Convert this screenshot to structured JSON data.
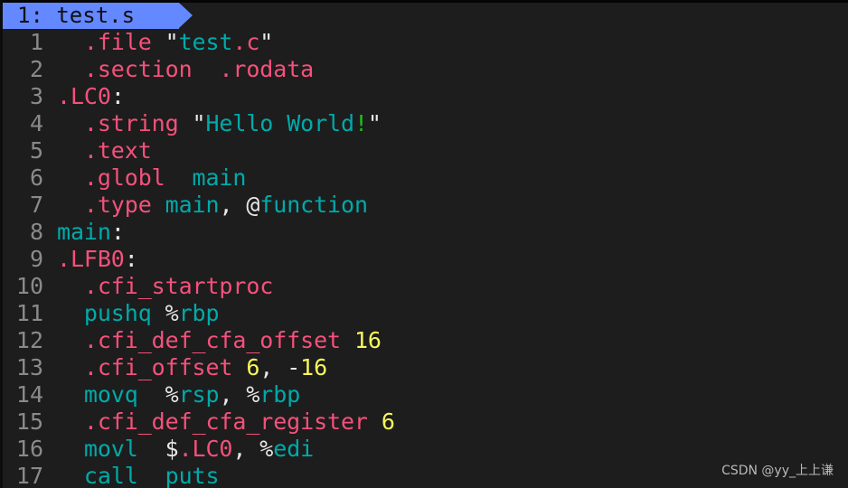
{
  "tabline": {
    "active_tab": "1: test.s"
  },
  "theme": {
    "background": "#1d1d1d",
    "tab_bg": "#6488ff",
    "directive_color": "#f5517b",
    "identifier_color": "#00aaaa",
    "number_color": "#f7f75a",
    "punct_color": "#e8e8e8",
    "escape_color": "#1fc11f",
    "line_number_color": "#8a8a8a"
  },
  "editor": {
    "lines": [
      {
        "n": "1",
        "tokens": [
          [
            "  ",
            "white"
          ],
          [
            ".file",
            "pink"
          ],
          [
            " \"",
            "white"
          ],
          [
            "test",
            "teal"
          ],
          [
            ".c",
            "pink"
          ],
          [
            "\"",
            "white"
          ]
        ]
      },
      {
        "n": "2",
        "tokens": [
          [
            "  ",
            "white"
          ],
          [
            ".section",
            "pink"
          ],
          [
            "  ",
            "white"
          ],
          [
            ".rodata",
            "pink"
          ]
        ]
      },
      {
        "n": "3",
        "tokens": [
          [
            ".LC0",
            "pink"
          ],
          [
            ":",
            "white"
          ]
        ]
      },
      {
        "n": "4",
        "tokens": [
          [
            "  ",
            "white"
          ],
          [
            ".string",
            "pink"
          ],
          [
            " \"",
            "white"
          ],
          [
            "Hello World",
            "teal"
          ],
          [
            "!",
            "green"
          ],
          [
            "\"",
            "white"
          ]
        ]
      },
      {
        "n": "5",
        "tokens": [
          [
            "  ",
            "white"
          ],
          [
            ".text",
            "pink"
          ]
        ]
      },
      {
        "n": "6",
        "tokens": [
          [
            "  ",
            "white"
          ],
          [
            ".globl",
            "pink"
          ],
          [
            "  ",
            "white"
          ],
          [
            "main",
            "teal"
          ]
        ]
      },
      {
        "n": "7",
        "tokens": [
          [
            "  ",
            "white"
          ],
          [
            ".type",
            "pink"
          ],
          [
            " ",
            "white"
          ],
          [
            "main",
            "teal"
          ],
          [
            ", ",
            "white"
          ],
          [
            "@",
            "white"
          ],
          [
            "function",
            "teal"
          ]
        ]
      },
      {
        "n": "8",
        "tokens": [
          [
            "main",
            "teal"
          ],
          [
            ":",
            "white"
          ]
        ]
      },
      {
        "n": "9",
        "tokens": [
          [
            ".LFB0",
            "pink"
          ],
          [
            ":",
            "white"
          ]
        ]
      },
      {
        "n": "10",
        "tokens": [
          [
            "  ",
            "white"
          ],
          [
            ".cfi_startproc",
            "pink"
          ]
        ]
      },
      {
        "n": "11",
        "tokens": [
          [
            "  ",
            "white"
          ],
          [
            "pushq",
            "teal"
          ],
          [
            " ",
            "white"
          ],
          [
            "%",
            "white"
          ],
          [
            "rbp",
            "teal"
          ]
        ]
      },
      {
        "n": "12",
        "tokens": [
          [
            "  ",
            "white"
          ],
          [
            ".cfi_def_cfa_offset",
            "pink"
          ],
          [
            " ",
            "white"
          ],
          [
            "16",
            "yellow"
          ]
        ]
      },
      {
        "n": "13",
        "tokens": [
          [
            "  ",
            "white"
          ],
          [
            ".cfi_offset",
            "pink"
          ],
          [
            " ",
            "white"
          ],
          [
            "6",
            "yellow"
          ],
          [
            ", ",
            "white"
          ],
          [
            "-",
            "white"
          ],
          [
            "16",
            "yellow"
          ]
        ]
      },
      {
        "n": "14",
        "tokens": [
          [
            "  ",
            "white"
          ],
          [
            "movq",
            "teal"
          ],
          [
            "  ",
            "white"
          ],
          [
            "%",
            "white"
          ],
          [
            "rsp",
            "teal"
          ],
          [
            ", ",
            "white"
          ],
          [
            "%",
            "white"
          ],
          [
            "rbp",
            "teal"
          ]
        ]
      },
      {
        "n": "15",
        "tokens": [
          [
            "  ",
            "white"
          ],
          [
            ".cfi_def_cfa_register",
            "pink"
          ],
          [
            " ",
            "white"
          ],
          [
            "6",
            "yellow"
          ]
        ]
      },
      {
        "n": "16",
        "tokens": [
          [
            "  ",
            "white"
          ],
          [
            "movl",
            "teal"
          ],
          [
            "  ",
            "white"
          ],
          [
            "$",
            "white"
          ],
          [
            ".LC0",
            "pink"
          ],
          [
            ", ",
            "white"
          ],
          [
            "%",
            "white"
          ],
          [
            "edi",
            "teal"
          ]
        ]
      },
      {
        "n": "17",
        "tokens": [
          [
            "  ",
            "white"
          ],
          [
            "call",
            "teal"
          ],
          [
            "  ",
            "white"
          ],
          [
            "puts",
            "teal"
          ]
        ]
      }
    ]
  },
  "watermark": "CSDN @yy_上上谦"
}
